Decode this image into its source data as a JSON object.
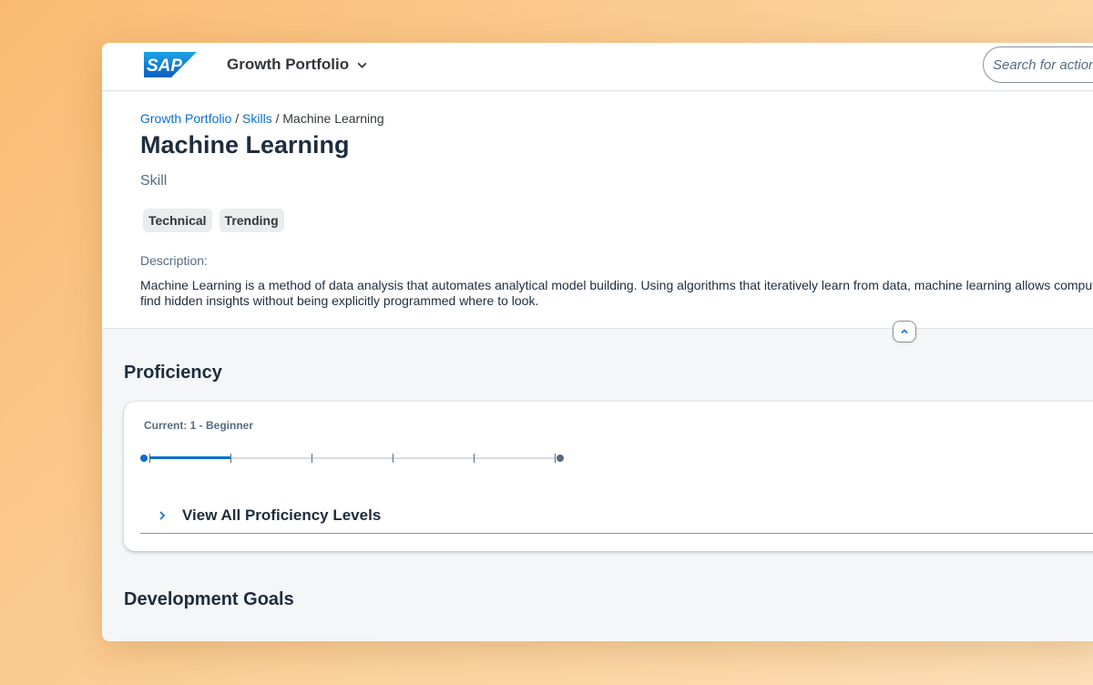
{
  "shell": {
    "logo_text": "SAP",
    "app_title": "Growth Portfolio",
    "search_placeholder": "Search for actions"
  },
  "breadcrumb": {
    "items": [
      "Growth Portfolio",
      "Skills"
    ],
    "separator": " / ",
    "current": "Machine Learning"
  },
  "header": {
    "title": "Machine Learning",
    "subtitle": "Skill",
    "tags": [
      "Technical",
      "Trending"
    ],
    "description_label": "Description:",
    "description": "Machine Learning is a method of data analysis that automates analytical model building. Using algorithms that iteratively learn from data, machine learning allows computers to find hidden insights without being explicitly programmed where to look."
  },
  "proficiency": {
    "section_title": "Proficiency",
    "current_label": "Current: 1 - Beginner",
    "current_level": 1,
    "total_levels": 5,
    "expander_label": "View All Proficiency Levels"
  },
  "goals": {
    "section_title": "Development Goals"
  },
  "colors": {
    "accent": "#0a6ed1",
    "sap_blue": "#1a7ed9",
    "text": "#1d2d3e",
    "muted": "#556b82"
  }
}
